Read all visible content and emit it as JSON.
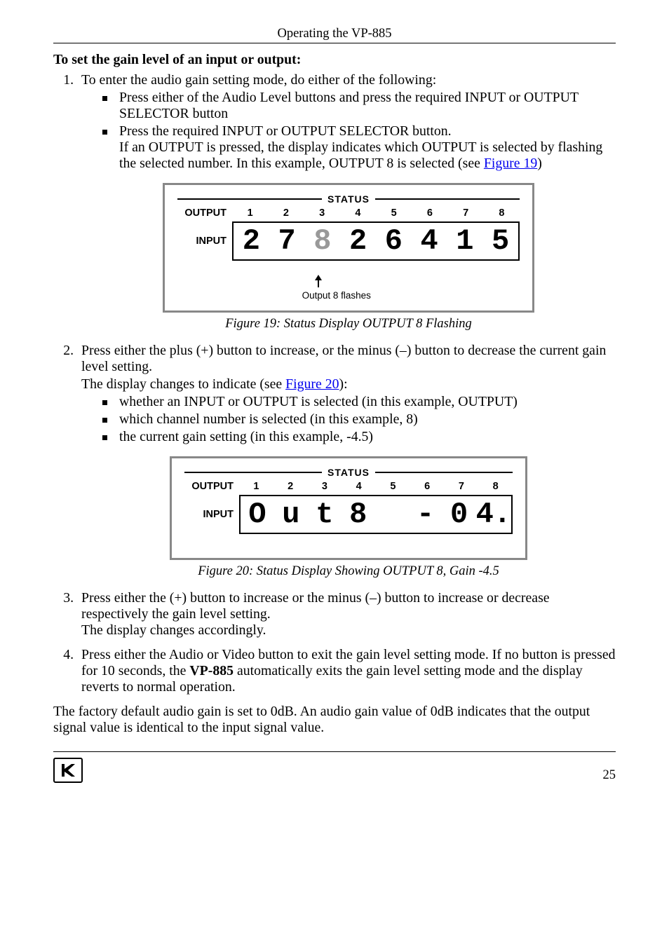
{
  "header": {
    "running_title": "Operating the VP-885"
  },
  "section_title": "To set the gain level of an input or output:",
  "steps": {
    "s1": {
      "text": "To enter the audio gain setting mode, do either of the following:",
      "b1": "Press either of the Audio Level buttons and press the required INPUT or OUTPUT SELECTOR button",
      "b2a": "Press the required INPUT or OUTPUT SELECTOR button.",
      "b2b": "If an OUTPUT is pressed, the display indicates which OUTPUT is selected by flashing the selected number. In this example, OUTPUT 8 is selected (see ",
      "b2link": "Figure 19",
      "b2c": ")"
    },
    "s2": {
      "text_a": "Press either the plus (+) button to increase, or the minus (–) button to decrease the current gain level setting.",
      "text_b": "The display changes to indicate (see ",
      "link": "Figure 20",
      "text_c": "):",
      "b1": "whether an INPUT or OUTPUT is selected (in this example, OUTPUT)",
      "b2": "which channel number is selected (in this example, 8)",
      "b3": "the current gain setting (in this example, -4.5)"
    },
    "s3": {
      "text_a": "Press either the (+) button to increase or the minus (–) button to increase or decrease respectively the gain level setting.",
      "text_b": "The display changes accordingly."
    },
    "s4": {
      "text_a": "Press either the Audio or Video button to exit the gain level setting mode. If no button is pressed for 10 seconds, the ",
      "bold": "VP-885",
      "text_b": " automatically exits the gain level setting mode and the display reverts to normal operation."
    }
  },
  "figure19": {
    "status_label": "STATUS",
    "output_label": "OUTPUT",
    "input_label": "INPUT",
    "nums": [
      "1",
      "2",
      "3",
      "4",
      "5",
      "6",
      "7",
      "8"
    ],
    "segs": [
      "2",
      "7",
      "8",
      "2",
      "6",
      "4",
      "1",
      "5"
    ],
    "flash_caption": "Output 8 flashes",
    "caption": "Figure 19: Status Display OUTPUT 8 Flashing"
  },
  "figure20": {
    "status_label": "STATUS",
    "output_label": "OUTPUT",
    "input_label": "INPUT",
    "nums": [
      "1",
      "2",
      "3",
      "4",
      "5",
      "6",
      "7",
      "8"
    ],
    "segs": [
      "O",
      "u",
      "t",
      "8",
      "",
      "-",
      "0",
      "4."
    ],
    "caption": "Figure 20: Status Display Showing OUTPUT 8, Gain -4.5"
  },
  "closing_para": "The factory default audio gain is set to 0dB. An audio gain value of 0dB indicates that the output signal value is identical to the input signal value.",
  "footer": {
    "page_number": "25"
  }
}
